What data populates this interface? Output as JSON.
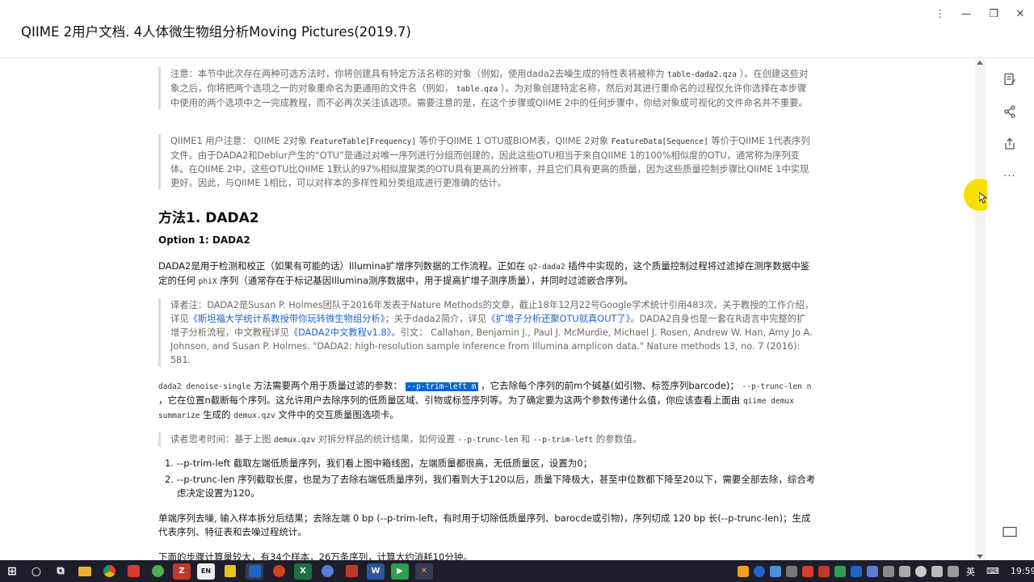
{
  "window": {
    "title": "QIIME 2用户文档. 4人体微生物组分析Moving Pictures(2019.7)",
    "controls": {
      "more": "⋮",
      "minimize": "—",
      "restore": "❐",
      "close": "✕"
    }
  },
  "doc": {
    "note1": {
      "t1": "注意：本节中此次存在两种可选方法时，你将创建具有特定方法名称的对象（例如，使用dada2去噪生成的特性表将被称为 ",
      "c1": "table-dada2.qza",
      "t2": " ）。在创建这些对象之后，你将把两个选项之一的对象重命名为更通用的文件名（例如， ",
      "c2": "table.qza",
      "t3": " ）。为对象创建特定名称，然后对其进行重命名的过程仅允许你选择在本步骤中使用的两个选项中之一完成教程，而不必再次关注该选项。需要注意的是，在这个步骤或QIIME 2中的任何步骤中，你给对象或可视化的文件命名并不重要。"
    },
    "note2": {
      "t1": "QIIME1 用户注意： QIIME 2对象 ",
      "c1": "FeatureTable[Frequency]",
      "t2": " 等价于QIIME 1 OTU或BIOM表，QIIME 2对象 ",
      "c2": "FeatureData[Sequence]",
      "t3": " 等价于QIIME 1代表序列文件。由于DADA2和Deblur产生的“OTU”是通过对唯一序列进行分组而创建的，因此这些OTU相当于来自QIIME 1的100%相似度的OTU，通常称为序列变体。在QIIME 2中，这些OTU比QIIME 1默认的97%相似度聚类的OTU具有更高的分辨率，并且它们具有更高的质量，因为这些质量控制步骤比QIIME 1中实现更好。因此，与QIIME 1相比，可以对样本的多样性和分类组成进行更准确的估计。"
    },
    "heading_method": "方法1. DADA2",
    "heading_option": "Option 1: DADA2",
    "para_dada2": {
      "t1": "DADA2是用于检测和校正（如果有可能的话）Illumina扩增序列数据的工作流程。正如在 ",
      "c1": "q2-dada2",
      "t2": " 插件中实现的，这个质量控制过程将过滤掉在测序数据中鉴定的任何 ",
      "c2": "phiX",
      "t3": " 序列（通常存在于标记基因Illumina测序数据中，用于提高扩增子测序质量），并同时过滤嵌合序列。"
    },
    "translator_note": {
      "t1": "译者注：DADA2是Susan P. Holmes团队于2016年发表于Nature Methods的文章，截止18年12月22号Google学术统计引用483次，关于教授的工作介绍，详见",
      "l1": "《斯坦福大学统计系教授带你玩转微生物组分析》",
      "t2": "；关于dada2简介，详见",
      "l2": "《扩增子分析还聚OTU就真OUT了》",
      "t3": "。DADA2自身也是一套在R语言中完整的扩增子分析流程，中文教程详见",
      "l3": "《DADA2中文教程v1.8》",
      "t4": "。引文： Callahan, Benjamin J., Paul J. McMurdie, Michael J. Rosen, Andrew W. Han, Amy Jo A. Johnson, and Susan P. Holmes. \"DADA2: high-resolution sample inference from Illumina amplicon data.\" Nature methods 13, no. 7 (2016): 581."
    },
    "para_denoise": {
      "c1": "dada2 denoise-single",
      "t1": " 方法需要两个用于质量过滤的参数： ",
      "c2": "--p-trim-left m",
      "t2": " ，它去除每个序列的前m个碱基(如引物、标签序列barcode)； ",
      "c3": "--p-trunc-len n",
      "t3": " ，它在位置n截断每个序列。这允许用户去除序列的低质量区域、引物或标签序列等。为了确定要为这两个参数传递什么值，你应该查看上面由 ",
      "c4": "qiime demux summarize",
      "t4": " 生成的 ",
      "c5": "demux.qzv",
      "t5": " 文件中的交互质量图选项卡。"
    },
    "reader_note": {
      "t1": "读者思考时间：基于上图 ",
      "c1": "demux.qzv",
      "t2": " 对拆分样品的统计结果，如何设置 ",
      "c2": "--p-trunc-len",
      "t3": " 和 ",
      "c3": "--p-trim-left",
      "t4": " 的参数值。"
    },
    "steps": [
      {
        "num": "1.",
        "text": "--p-trim-left 截取左端低质量序列，我们看上图中箱线图，左端质量都很高，无低质量区，设置为0；"
      },
      {
        "num": "2.",
        "text": "--p-trunc-len 序列截取长度，也是为了去除右端低质量序列，我们看到大于120以后，质量下降极大，甚至中位数都下降至20以下，需要全部去除，综合考虑决定设置为120。"
      }
    ],
    "para_single": "单端序列去噪, 输入样本拆分后结果；去除左端 0 bp (--p-trim-left，有时用于切除低质量序列、barocde或引物)，序列切成 120 bp 长(--p-trunc-len)；生成代表序列、特征表和去噪过程统计。",
    "para_last": "下面的步骤计算量较大，有34个样本，26万条序列，计算大约消耗10分钟。"
  },
  "rail": {
    "icons": [
      "notes-icon",
      "share-icon",
      "export-icon",
      "more-icon",
      "fullscreen-icon"
    ],
    "more_label": "···"
  },
  "taskbar": {
    "apps": [
      {
        "name": "start-icon",
        "label": "⊞",
        "color": "#ffffff"
      },
      {
        "name": "search-icon",
        "label": "○",
        "color": "#ffffff"
      },
      {
        "name": "taskview-icon",
        "label": "⧉",
        "color": "#ffffff"
      },
      {
        "name": "explorer-icon",
        "label": "",
        "color": "#e8b32a"
      },
      {
        "name": "chrome-icon",
        "label": "",
        "color": "#3b8d45"
      },
      {
        "name": "app-red-icon",
        "label": "",
        "color": "#d83b2f"
      },
      {
        "name": "app-green-icon",
        "label": "",
        "color": "#4caf50"
      },
      {
        "name": "filezilla-icon",
        "label": "Z",
        "color": "#c0392b"
      },
      {
        "name": "app-en-icon",
        "label": "EN",
        "color": "#2d2d2d"
      },
      {
        "name": "notes-app-icon",
        "label": "",
        "color": "#e8c020"
      },
      {
        "name": "reader-app-icon",
        "label": "",
        "color": "#1f64c8"
      },
      {
        "name": "pdf-icon",
        "label": "",
        "color": "#d0421b"
      },
      {
        "name": "excel-icon",
        "label": "X",
        "color": "#1e7145"
      },
      {
        "name": "app-blue-icon",
        "label": "",
        "color": "#5b7bd6"
      },
      {
        "name": "ppt-icon",
        "label": "",
        "color": "#c0392b"
      },
      {
        "name": "word-icon",
        "label": "W",
        "color": "#2b579a"
      },
      {
        "name": "player-icon",
        "label": "▶",
        "color": "#2e9e52"
      },
      {
        "name": "tool-icon",
        "label": "✕",
        "color": "#f0a020"
      }
    ],
    "tray": {
      "lang": "英",
      "time": "19:59"
    }
  }
}
